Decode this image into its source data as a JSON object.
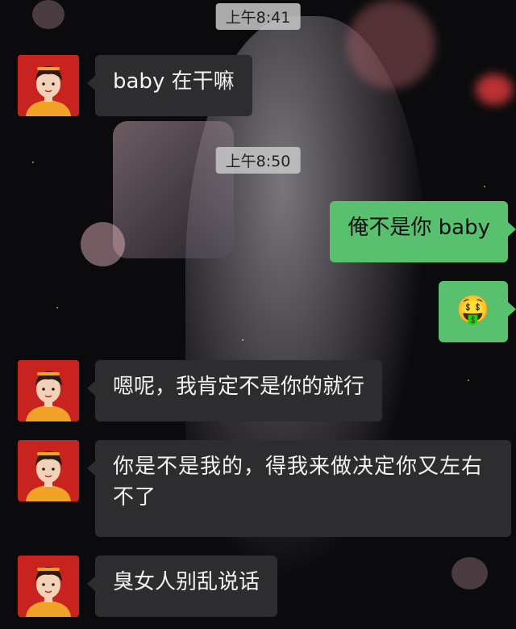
{
  "chat": {
    "timestamps": [
      "上午8:41",
      "上午8:50"
    ],
    "messages": [
      {
        "side": "left",
        "text": "baby 在干嘛"
      },
      {
        "side": "right",
        "text": "俺不是你 baby"
      },
      {
        "side": "right",
        "text": "🤑"
      },
      {
        "side": "left",
        "text": "嗯呢，我肯定不是你的就行"
      },
      {
        "side": "left",
        "text": "你是不是我的，得我来做决定你又左右不了"
      },
      {
        "side": "left",
        "text": "臭女人别乱说话"
      }
    ]
  },
  "colors": {
    "outgoing_bubble": "#58c06e",
    "incoming_bubble": "#2d2d2f",
    "avatar_bg": "#c8231e"
  },
  "icons": {
    "avatar": "cartoon-boy-avatar",
    "emoji": "money-mouth-face"
  }
}
